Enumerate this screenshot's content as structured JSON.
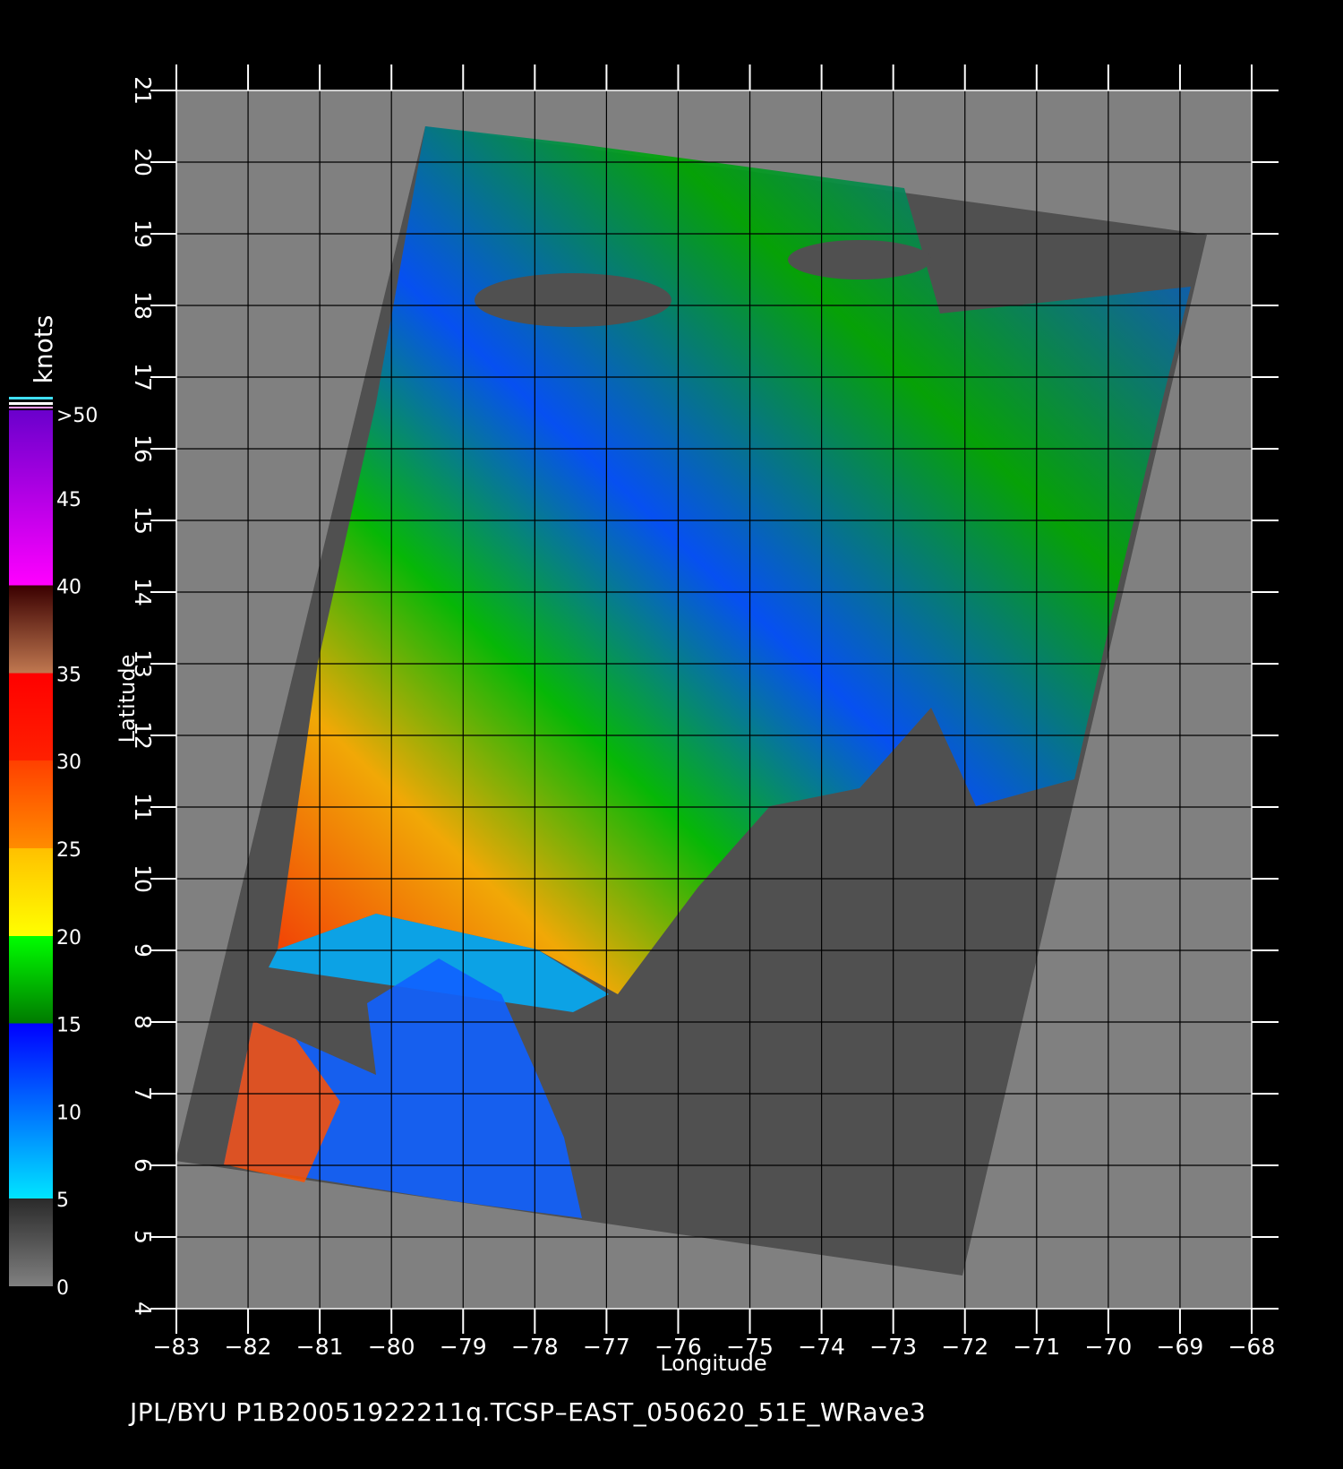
{
  "map": {
    "x_axis": {
      "label": "Longitude",
      "min": -83,
      "max": -68,
      "ticks": [
        -83,
        -82,
        -81,
        -80,
        -79,
        -78,
        -77,
        -76,
        -75,
        -74,
        -73,
        -72,
        -71,
        -70,
        -69,
        -68
      ],
      "tick_labels": [
        "−83",
        "−82",
        "−81",
        "−80",
        "−79",
        "−78",
        "−77",
        "−76",
        "−75",
        "−74",
        "−73",
        "−72",
        "−71",
        "−70",
        "−69",
        "−68"
      ]
    },
    "y_axis": {
      "label": "Latitude",
      "min": 4,
      "max": 21,
      "ticks": [
        4,
        5,
        6,
        7,
        8,
        9,
        10,
        11,
        12,
        13,
        14,
        15,
        16,
        17,
        18,
        19,
        20,
        21
      ],
      "tick_labels": [
        "4",
        "5",
        "6",
        "7",
        "8",
        "9",
        "10",
        "11",
        "12",
        "13",
        "14",
        "15",
        "16",
        "17",
        "18",
        "19",
        "20",
        "21"
      ]
    },
    "grid": true,
    "colors": {
      "outside_swath": "#808080",
      "swath_no_data": "#505050",
      "grid": "#000000"
    }
  },
  "colorbar": {
    "title": "knots",
    "labels": [
      ">50",
      "45",
      "40",
      "35",
      "30",
      "25",
      "20",
      "15",
      "10",
      "5",
      "0"
    ],
    "levels": [
      50,
      45,
      40,
      35,
      30,
      25,
      20,
      15,
      10,
      5,
      0
    ],
    "bands": [
      {
        "range": "0-5",
        "color_bottom": "#808080",
        "color_top": "#2a2a2a"
      },
      {
        "range": "5-15",
        "color_bottom": "#00e5ff",
        "color_top": "#0000ff"
      },
      {
        "range": "15-20",
        "color_bottom": "#007a00",
        "color_top": "#00ff00"
      },
      {
        "range": "20-25",
        "color_bottom": "#ffff00",
        "color_top": "#ffc000"
      },
      {
        "range": "25-30",
        "color_bottom": "#ff8c00",
        "color_top": "#ff4000"
      },
      {
        "range": "30-35",
        "color_bottom": "#ff2000",
        "color_top": "#ff0000"
      },
      {
        "range": "35-40",
        "color_bottom": "#c07850",
        "color_top": "#3a0000"
      },
      {
        "range": "40-50",
        "color_bottom": "#ff00ff",
        "color_top": "#6a00cc"
      }
    ]
  },
  "footer": {
    "text": "JPL/BYU  P1B20051922211q.TCSP–EAST_050620_51E_WRave3"
  }
}
